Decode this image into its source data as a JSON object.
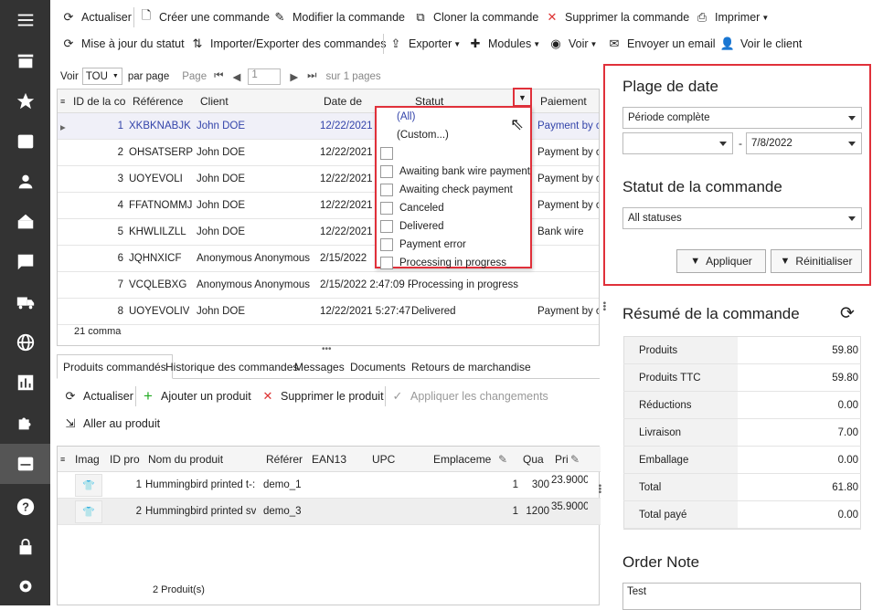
{
  "toolbar1": {
    "refresh": "Actualiser",
    "create": "Créer une commande",
    "edit": "Modifier la commande",
    "clone": "Cloner la commande",
    "delete": "Supprimer la commande",
    "print": "Imprimer"
  },
  "toolbar2": {
    "update_status": "Mise à jour du statut",
    "import_export": "Importer/Exporter des commandes",
    "export": "Exporter",
    "modules": "Modules",
    "view": "Voir",
    "email": "Envoyer un email",
    "view_client": "Voir le client"
  },
  "pager": {
    "view_label": "Voir",
    "per_page_value": "TOU",
    "per_page_label": "par page",
    "page_label": "Page",
    "page_value": "1",
    "of_pages": "sur 1 pages"
  },
  "grid": {
    "headers": [
      "ID de la co",
      "Référence",
      "Client",
      "Date de",
      "Statut",
      "Paiement"
    ],
    "rows": [
      {
        "id": "1",
        "ref": "XKBKNABJK",
        "client": "John DOE",
        "date": "12/22/2021",
        "status": "",
        "payment": "Payment by cl"
      },
      {
        "id": "2",
        "ref": "OHSATSERP",
        "client": "John DOE",
        "date": "12/22/2021",
        "status": "",
        "payment": "Payment by cl"
      },
      {
        "id": "3",
        "ref": "UOYEVOLI",
        "client": "John DOE",
        "date": "12/22/2021",
        "status": "",
        "payment": "Payment by cl"
      },
      {
        "id": "4",
        "ref": "FFATNOMMJ",
        "client": "John DOE",
        "date": "12/22/2021",
        "status": "",
        "payment": "Payment by cl"
      },
      {
        "id": "5",
        "ref": "KHWLILZLL",
        "client": "John DOE",
        "date": "12/22/2021",
        "status": "",
        "payment": "Bank wire"
      },
      {
        "id": "6",
        "ref": "JQHNXICF",
        "client": "Anonymous Anonymous",
        "date": "2/15/2022",
        "status": "",
        "payment": ""
      },
      {
        "id": "7",
        "ref": "VCQLEBXG",
        "client": "Anonymous Anonymous",
        "date": "2/15/2022 2:47:09 P",
        "status": "Processing in progress",
        "payment": ""
      },
      {
        "id": "8",
        "ref": "UOYEVOLIV",
        "client": "John DOE",
        "date": "12/22/2021 5:27:47",
        "status": "Delivered",
        "payment": "Payment by cl"
      }
    ],
    "footer": "21 comma"
  },
  "status_filter": {
    "items": [
      "(All)",
      "(Custom...)",
      "",
      "Awaiting bank wire payment",
      "Awaiting check payment",
      "Canceled",
      "Delivered",
      "Payment error",
      "Processing in progress"
    ]
  },
  "date_range": {
    "title": "Plage de date",
    "period": "Période complète",
    "from": "",
    "dash": "-",
    "to": "7/8/2022",
    "status_title": "Statut de la commande",
    "status_value": "All statuses",
    "apply": "Appliquer",
    "reset": "Réinitialiser"
  },
  "summary": {
    "title": "Résumé de la commande",
    "rows": [
      {
        "label": "Produits",
        "value": "59.80"
      },
      {
        "label": "Produits TTC",
        "value": "59.80"
      },
      {
        "label": "Réductions",
        "value": "0.00"
      },
      {
        "label": "Livraison",
        "value": "7.00"
      },
      {
        "label": "Emballage",
        "value": "0.00"
      },
      {
        "label": "Total",
        "value": "61.80"
      },
      {
        "label": "Total payé",
        "value": "0.00"
      }
    ]
  },
  "note": {
    "title": "Order Note",
    "value": "Test"
  },
  "tabs": [
    "Produits commandés",
    "Historique des commandes",
    "Messages",
    "Documents",
    "Retours de marchandise"
  ],
  "ptoolbar": {
    "refresh": "Actualiser",
    "add": "Ajouter un produit",
    "delete": "Supprimer le produit",
    "apply": "Appliquer les changements",
    "goto": "Aller au produit"
  },
  "products": {
    "headers": [
      "Imag",
      "ID pro",
      "Nom du produit",
      "Référer",
      "EAN13",
      "UPC",
      "Emplaceme",
      "Qua",
      "Pri"
    ],
    "rows": [
      {
        "id": "1",
        "name": "Hummingbird printed t-:",
        "ref": "demo_1",
        "qty": "1",
        "stock": "300",
        "price": "23.9000"
      },
      {
        "id": "2",
        "name": "Hummingbird printed sv",
        "ref": "demo_3",
        "qty": "1",
        "stock": "1200",
        "price": "35.9000"
      }
    ],
    "footer": "2 Produit(s)"
  },
  "colors": {
    "sidebar": "#333333",
    "highlight": "#e0303a",
    "selected_text": "#3344aa"
  }
}
